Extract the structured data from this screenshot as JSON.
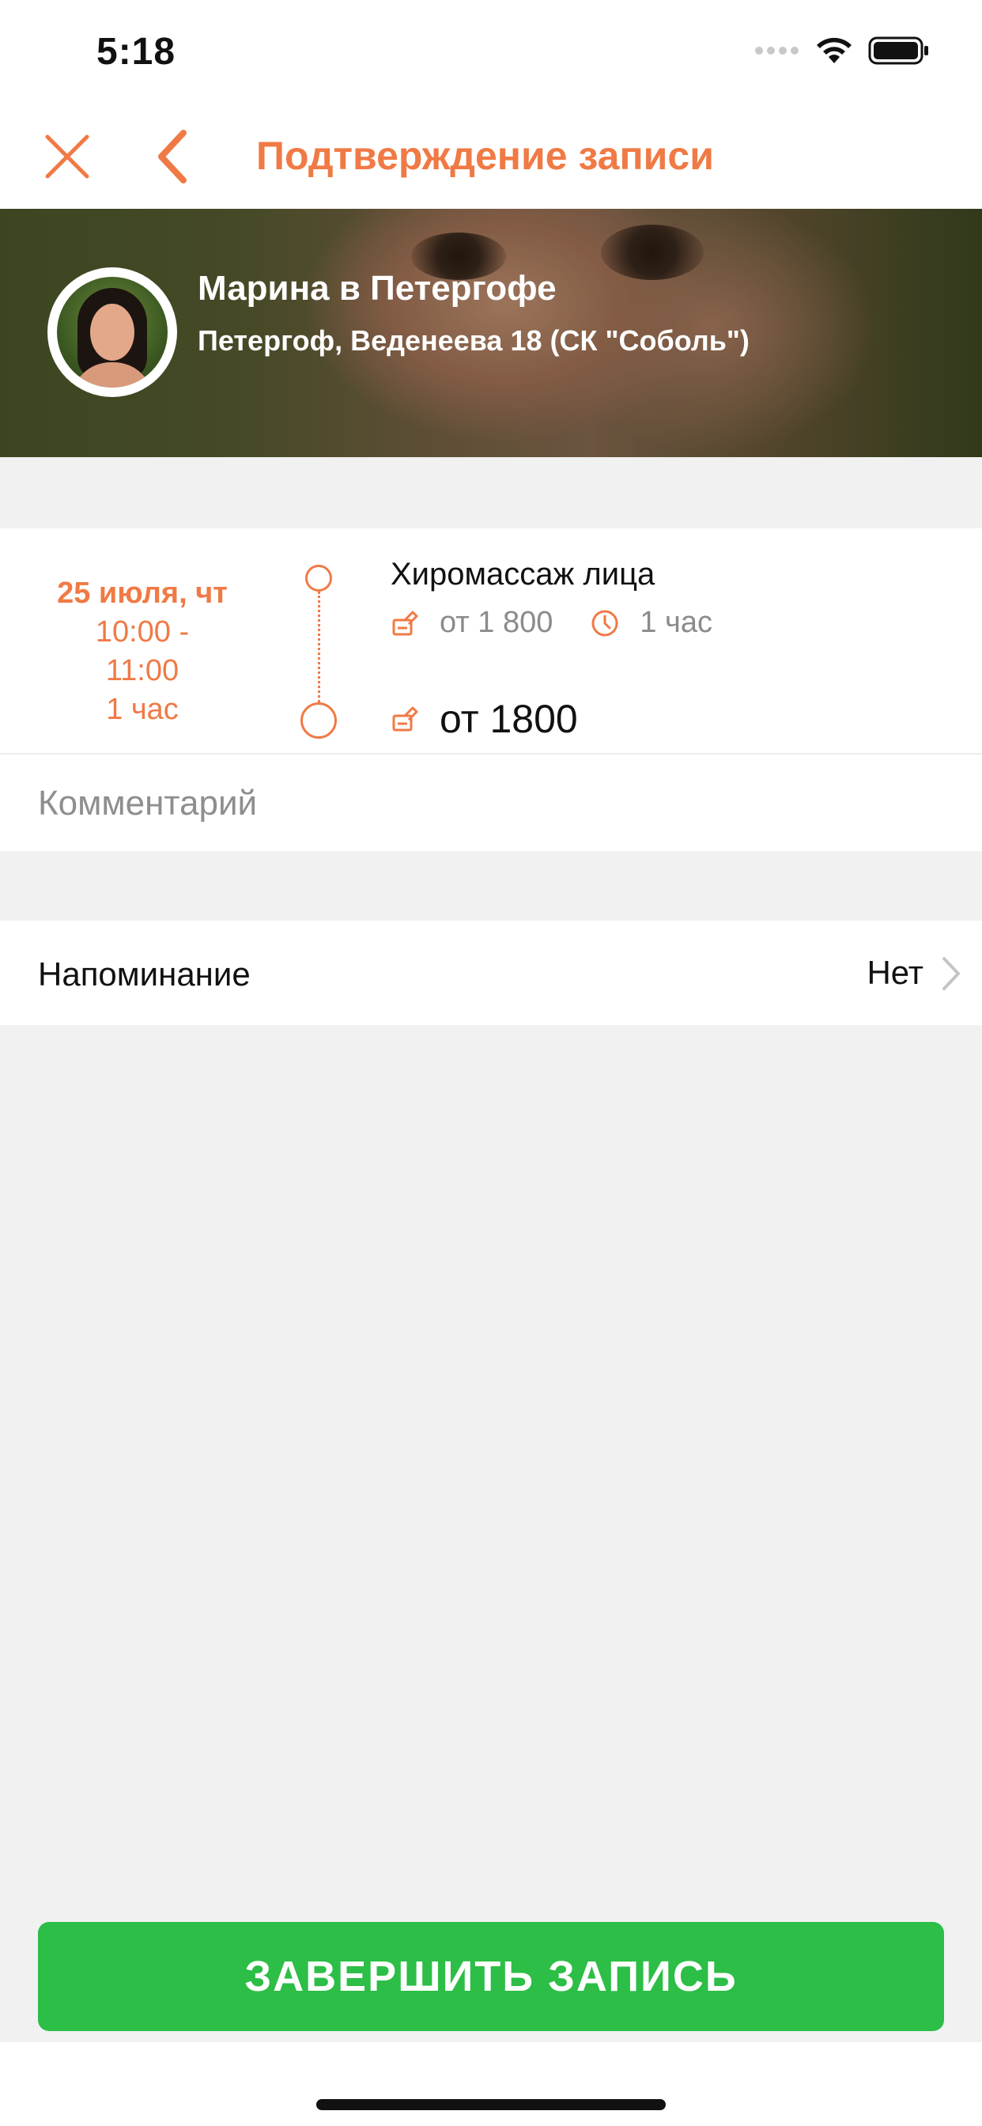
{
  "status_bar": {
    "time": "5:18"
  },
  "nav": {
    "title": "Подтверждение записи",
    "accent_color": "#f07a45"
  },
  "master": {
    "name": "Марина в Петергофе",
    "address": "Петергоф, Веденеева 18 (СК \"Соболь\")"
  },
  "appointment": {
    "date": "25 июля, чт",
    "time_range_start": "10:00 -",
    "time_range_end": "11:00",
    "duration": "1 час",
    "service_name": "Хиромассаж лица",
    "service_price": "от 1 800",
    "service_duration": "1 час",
    "total_price": "от 1800"
  },
  "comment": {
    "placeholder": "Комментарий",
    "value": ""
  },
  "reminder": {
    "label": "Напоминание",
    "value": "Нет"
  },
  "actions": {
    "finish_label": "ЗАВЕРШИТЬ ЗАПИСЬ",
    "finish_color": "#2cbe46"
  },
  "icons": {
    "close": "close-icon",
    "back": "chevron-left-icon",
    "price": "price-tag-icon",
    "clock": "clock-icon",
    "chevron": "chevron-right-icon"
  }
}
